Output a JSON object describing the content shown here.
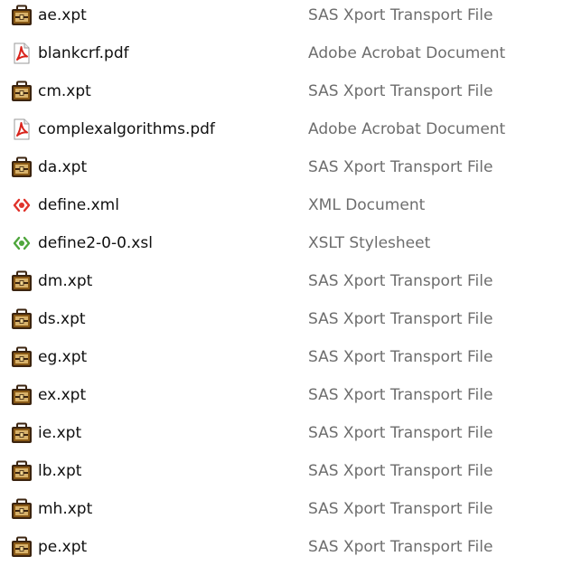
{
  "files": [
    {
      "name": "ae.xpt",
      "type": "SAS Xport Transport File",
      "icon": "sas-xpt-icon"
    },
    {
      "name": "blankcrf.pdf",
      "type": "Adobe Acrobat Document",
      "icon": "pdf-icon"
    },
    {
      "name": "cm.xpt",
      "type": "SAS Xport Transport File",
      "icon": "sas-xpt-icon"
    },
    {
      "name": "complexalgorithms.pdf",
      "type": "Adobe Acrobat Document",
      "icon": "pdf-icon"
    },
    {
      "name": "da.xpt",
      "type": "SAS Xport Transport File",
      "icon": "sas-xpt-icon"
    },
    {
      "name": "define.xml",
      "type": "XML Document",
      "icon": "xml-icon"
    },
    {
      "name": "define2-0-0.xsl",
      "type": "XSLT Stylesheet",
      "icon": "xslt-icon"
    },
    {
      "name": "dm.xpt",
      "type": "SAS Xport Transport File",
      "icon": "sas-xpt-icon"
    },
    {
      "name": "ds.xpt",
      "type": "SAS Xport Transport File",
      "icon": "sas-xpt-icon"
    },
    {
      "name": "eg.xpt",
      "type": "SAS Xport Transport File",
      "icon": "sas-xpt-icon"
    },
    {
      "name": "ex.xpt",
      "type": "SAS Xport Transport File",
      "icon": "sas-xpt-icon"
    },
    {
      "name": "ie.xpt",
      "type": "SAS Xport Transport File",
      "icon": "sas-xpt-icon"
    },
    {
      "name": "lb.xpt",
      "type": "SAS Xport Transport File",
      "icon": "sas-xpt-icon"
    },
    {
      "name": "mh.xpt",
      "type": "SAS Xport Transport File",
      "icon": "sas-xpt-icon"
    },
    {
      "name": "pe.xpt",
      "type": "SAS Xport Transport File",
      "icon": "sas-xpt-icon"
    }
  ],
  "colors": {
    "name_text": "#101010",
    "type_text": "#6d6d6d",
    "pdf_red": "#d9241c",
    "xml_red": "#e0332b",
    "xslt_green": "#4ea63c",
    "sas_body": "#8a5a17",
    "sas_dark": "#3b2410"
  }
}
